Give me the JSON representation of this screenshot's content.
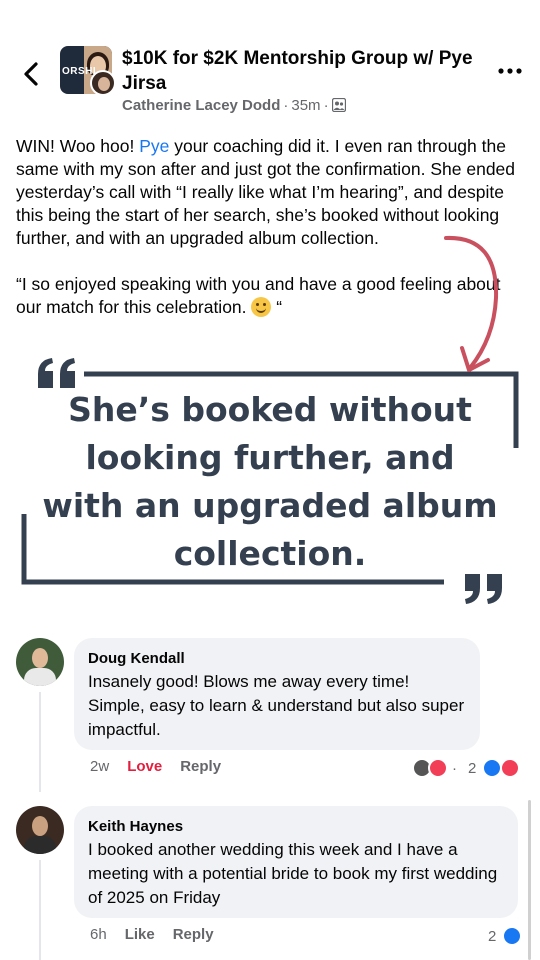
{
  "header": {
    "group_name": "$10K for $2K Mentorship Group w/ Pye Jirsa",
    "group_avatar_text": "ORSHI",
    "author": "Catherine Lacey Dodd",
    "time": "35m",
    "separator": "·"
  },
  "post": {
    "p1_a": "WIN! Woo hoo! ",
    "p1_mention": "Pye",
    "p1_b": " your coaching did it. I even ran through the same with my son after and just got the confirmation. She ended yesterday’s call with “I really like what I’m hearing”, and despite this being the start of her search, she’s booked without looking further, and with an upgraded album collection.",
    "p2": "“I so enjoyed speaking with you and have a good feeling about our match for this celebration. ",
    "p2_end": " “"
  },
  "quote": {
    "text": "She’s booked without looking further, and with an upgraded album collection."
  },
  "comments": [
    {
      "name": "Doug Kendall",
      "text": "Insanely good! Blows me away every time! Simple, easy to learn & understand but also super impactful.",
      "time": "2w",
      "reaction_label": "Love",
      "reply_label": "Reply",
      "reaction_count": "2",
      "reaction_dot": "·"
    },
    {
      "name": "Keith Haynes",
      "text": "I booked another wedding this week and I have a meeting with a potential bride to book my first wedding of 2025 on Friday",
      "time": "6h",
      "reaction_label": "Like",
      "reply_label": "Reply",
      "reaction_count": "2"
    }
  ],
  "colors": {
    "accent": "#1877f2",
    "love": "#e41e3f",
    "quote_text": "#34404f",
    "arrow": "#c9515f"
  },
  "icons": {
    "back": "chevron-left-icon",
    "more": "more-horizontal-icon",
    "audience": "group-members-icon",
    "like": "like-reaction-icon",
    "love": "love-reaction-icon"
  }
}
